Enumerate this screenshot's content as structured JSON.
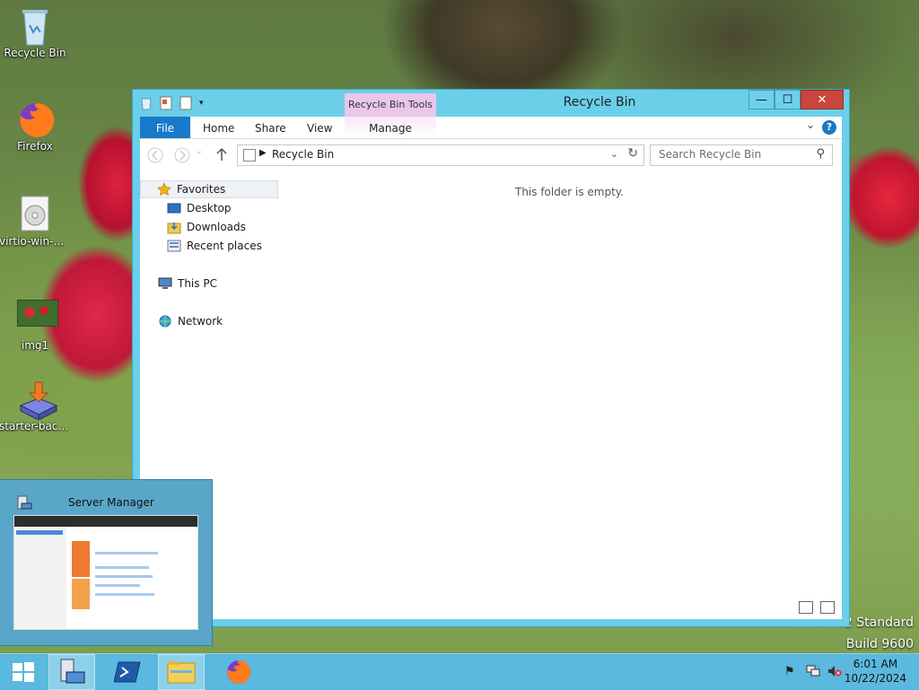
{
  "desktop": {
    "icons": [
      {
        "label": "Recycle Bin"
      },
      {
        "label": "Firefox"
      },
      {
        "label": "virtio-win-0...."
      },
      {
        "label": "img1"
      },
      {
        "label": "starter-back..."
      }
    ],
    "watermark": {
      "line1": "2 Standard",
      "line2": "Build 9600"
    }
  },
  "window": {
    "title": "Recycle Bin",
    "context_tab_group": "Recycle Bin Tools",
    "controls": {
      "minimize": "—",
      "maximize": "☐",
      "close": "✕"
    },
    "ribbon_tabs": [
      "File",
      "Home",
      "Share",
      "View",
      "Manage"
    ],
    "help": "?",
    "address": {
      "path": "Recycle Bin"
    },
    "search": {
      "placeholder": "Search Recycle Bin"
    },
    "nav": {
      "favorites": "Favorites",
      "desktop": "Desktop",
      "downloads": "Downloads",
      "recent": "Recent places",
      "this_pc": "This PC",
      "network": "Network"
    },
    "empty_message": "This folder is empty."
  },
  "thumbnail": {
    "title": "Server Manager"
  },
  "taskbar": {
    "clock": {
      "time": "6:01 AM",
      "date": "10/22/2024"
    }
  },
  "colors": {
    "accent": "#1979ca",
    "window_frame": "#6bcfea",
    "taskbar": "#5bb8de",
    "close": "#c9463d"
  }
}
